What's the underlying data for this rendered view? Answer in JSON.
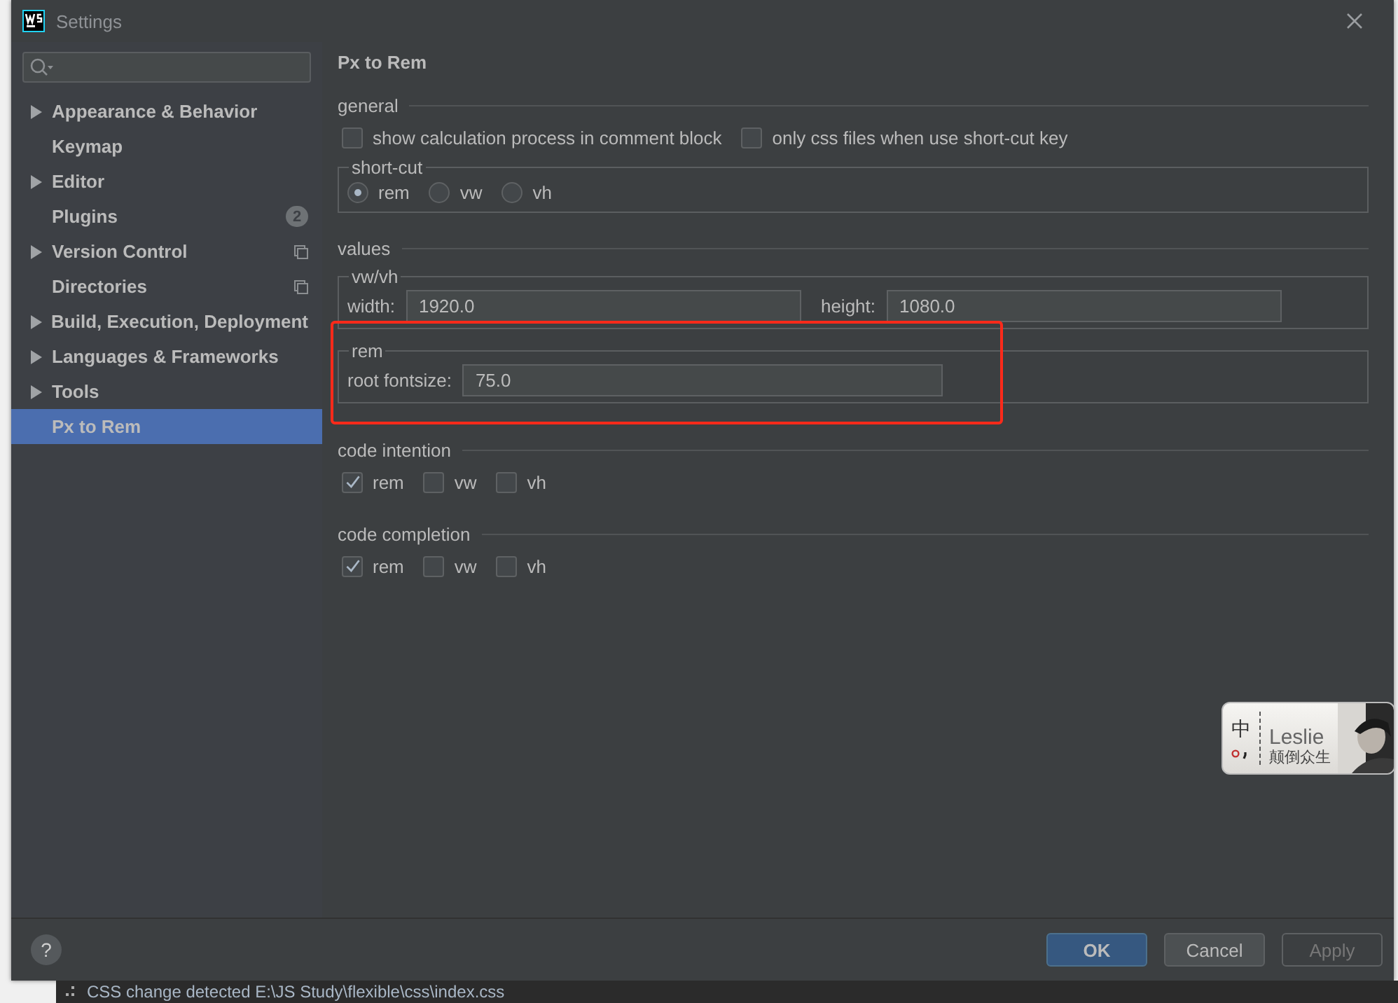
{
  "window": {
    "title": "Settings"
  },
  "sidebar": {
    "items": [
      {
        "label": "Appearance & Behavior",
        "expandable": true,
        "selected": false,
        "scope_icon": false
      },
      {
        "label": "Keymap",
        "expandable": false,
        "selected": false,
        "scope_icon": false
      },
      {
        "label": "Editor",
        "expandable": true,
        "selected": false,
        "scope_icon": false
      },
      {
        "label": "Plugins",
        "expandable": false,
        "selected": false,
        "scope_icon": false,
        "badge": "2"
      },
      {
        "label": "Version Control",
        "expandable": true,
        "selected": false,
        "scope_icon": true
      },
      {
        "label": "Directories",
        "expandable": false,
        "selected": false,
        "scope_icon": true
      },
      {
        "label": "Build, Execution, Deployment",
        "expandable": true,
        "selected": false,
        "scope_icon": false
      },
      {
        "label": "Languages & Frameworks",
        "expandable": true,
        "selected": false,
        "scope_icon": false
      },
      {
        "label": "Tools",
        "expandable": true,
        "selected": false,
        "scope_icon": false
      },
      {
        "label": "Px to Rem",
        "expandable": false,
        "selected": true,
        "scope_icon": false
      }
    ]
  },
  "content": {
    "title": "Px to Rem",
    "general": {
      "heading": "general",
      "checkboxes": [
        {
          "label": "show calculation process in comment block",
          "checked": false
        },
        {
          "label": "only css files when use short-cut key",
          "checked": false
        }
      ],
      "short_cut": {
        "title": "short-cut",
        "radios": [
          {
            "label": "rem",
            "selected": true
          },
          {
            "label": "vw",
            "selected": false
          },
          {
            "label": "vh",
            "selected": false
          }
        ]
      }
    },
    "values": {
      "heading": "values",
      "groups": [
        {
          "title": "vw/vh",
          "highlighted": false,
          "fields": [
            {
              "label": "width:",
              "value": "1920.0"
            },
            {
              "label": "height:",
              "value": "1080.0"
            }
          ]
        },
        {
          "title": "rem",
          "highlighted": true,
          "fields": [
            {
              "label": "root fontsize:",
              "value": "75.0"
            }
          ]
        }
      ]
    },
    "code_intention": {
      "heading": "code intention",
      "checkboxes": [
        {
          "label": "rem",
          "checked": true
        },
        {
          "label": "vw",
          "checked": false
        },
        {
          "label": "vh",
          "checked": false
        }
      ]
    },
    "code_completion": {
      "heading": "code completion",
      "checkboxes": [
        {
          "label": "rem",
          "checked": true
        },
        {
          "label": "vw",
          "checked": false
        },
        {
          "label": "vh",
          "checked": false
        }
      ]
    }
  },
  "footer": {
    "help": "?",
    "buttons": [
      {
        "label": "OK",
        "kind": "primary"
      },
      {
        "label": "Cancel",
        "kind": "normal"
      },
      {
        "label": "Apply",
        "kind": "disabled"
      }
    ]
  },
  "ime_toolbar": {
    "mode": "中",
    "name": "Leslie",
    "motto": "颠倒众生"
  },
  "background_status": {
    "text": "CSS change detected E:\\JS Study\\flexible\\css\\index.css"
  }
}
